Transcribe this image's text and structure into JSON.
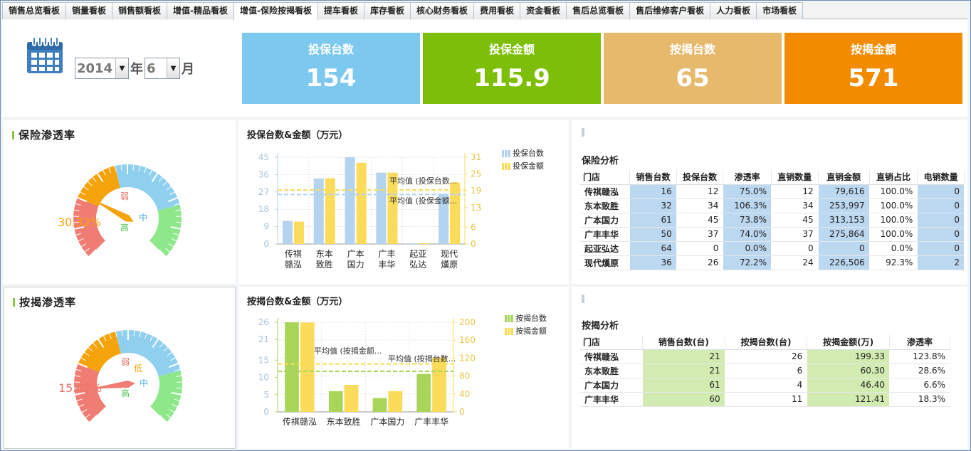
{
  "tabs": [
    {
      "label": "销售总览看板",
      "active": false
    },
    {
      "label": "销量看板",
      "active": false
    },
    {
      "label": "销售额看板",
      "active": false
    },
    {
      "label": "增值-精品看板",
      "active": false
    },
    {
      "label": "增值-保险按揭看板",
      "active": true
    },
    {
      "label": "提车看板",
      "active": false
    },
    {
      "label": "库存看板",
      "active": false
    },
    {
      "label": "核心财务看板",
      "active": false
    },
    {
      "label": "费用看板",
      "active": false
    },
    {
      "label": "资金看板",
      "active": false
    },
    {
      "label": "售后总览看板",
      "active": false
    },
    {
      "label": "售后维修客户看板",
      "active": false
    },
    {
      "label": "人力看板",
      "active": false
    },
    {
      "label": "市场看板",
      "active": false
    }
  ],
  "date": {
    "year": "2014",
    "year_unit": "年",
    "month": "6",
    "month_unit": "月",
    "icon": "calendar-icon"
  },
  "kpis": [
    {
      "title": "投保台数",
      "value": "154",
      "color": "#7cc8ef"
    },
    {
      "title": "投保金额",
      "value": "115.9",
      "color": "#7dbf08"
    },
    {
      "title": "按揭台数",
      "value": "65",
      "color": "#e6b96c"
    },
    {
      "title": "按揭金额",
      "value": "571",
      "color": "#f28b00"
    }
  ],
  "insurance_gauge": {
    "title": "保险渗透率",
    "percent_text": "30.32%",
    "percent_value": 30.32,
    "percent_color": "#f5a30a",
    "labels": {
      "weak": "弱",
      "mid": "中",
      "high": "高"
    }
  },
  "mortgage_gauge": {
    "title": "按揭渗透率",
    "percent_text": "15.67%",
    "percent_value": 15.67,
    "percent_color": "#f07367",
    "labels": {
      "weak": "弱",
      "low": "低",
      "mid": "中",
      "high": "高"
    }
  },
  "chart_data": [
    {
      "type": "bar",
      "title": "投保台数&金额（万元）",
      "categories": [
        "传祺\n赣泓",
        "东本\n致胜",
        "广本\n国力",
        "广丰\n丰华",
        "起亚\n弘达",
        "现代\n熯原"
      ],
      "series": [
        {
          "name": "投保台数",
          "values": [
            12,
            34,
            45,
            37,
            0,
            26
          ],
          "color": "#b4d3ee",
          "axis": "left"
        },
        {
          "name": "投保金额",
          "values": [
            8,
            23.5,
            29,
            25.5,
            0,
            22
          ],
          "color": "#fadc5a",
          "axis": "right"
        }
      ],
      "ylim_left": [
        0,
        45
      ],
      "yticks_left": [
        0,
        9,
        18,
        27,
        36,
        45
      ],
      "ylim_right": [
        0,
        31
      ],
      "yticks_right": [
        0,
        6,
        13,
        19,
        25,
        31
      ],
      "avg_lines": [
        {
          "label": "平均值 (投保台数...",
          "value": 25.7,
          "axis": "left",
          "color": "#b4d3ee"
        },
        {
          "label": "平均值 (投保金额...",
          "value": 19.3,
          "axis": "right",
          "color": "#fadc5a"
        }
      ],
      "legend": "top-right"
    },
    {
      "type": "bar",
      "title": "按揭台数&金额（万元）",
      "categories": [
        "传祺赣泓",
        "东本致胜",
        "广本国力",
        "广丰丰华"
      ],
      "series": [
        {
          "name": "按揭台数",
          "values": [
            26,
            6,
            4,
            11
          ],
          "color": "#a9d65a",
          "axis": "left"
        },
        {
          "name": "按揭金额",
          "values": [
            199.33,
            60.3,
            46.4,
            121.41
          ],
          "color": "#fadc5a",
          "axis": "right"
        }
      ],
      "ylim_left": [
        0,
        26
      ],
      "yticks_left": [
        0,
        5,
        10,
        15,
        21,
        26
      ],
      "ylim_right": [
        0,
        200
      ],
      "yticks_right": [
        0,
        40,
        80,
        120,
        160,
        200
      ],
      "avg_lines": [
        {
          "label": "平均值 (按揭金额...",
          "value": 106.9,
          "axis": "right",
          "color": "#fadc5a"
        },
        {
          "label": "平均值 (按揭台数...",
          "value": 11.75,
          "axis": "left",
          "color": "#a9d65a"
        }
      ],
      "legend": "top-right"
    }
  ],
  "insurance_table": {
    "title": "保险分析",
    "columns": [
      "门店",
      "销售台数",
      "投保台数",
      "渗透率",
      "直销数量",
      "直销金额",
      "直销占比",
      "电销数量"
    ],
    "rows": [
      [
        "传祺赣泓",
        "16",
        "12",
        "75.0%",
        "12",
        "79,616",
        "100.0%",
        "0"
      ],
      [
        "东本致胜",
        "32",
        "34",
        "106.3%",
        "34",
        "253,997",
        "100.0%",
        "0"
      ],
      [
        "广本国力",
        "61",
        "45",
        "73.8%",
        "45",
        "313,153",
        "100.0%",
        "0"
      ],
      [
        "广丰丰华",
        "50",
        "37",
        "74.0%",
        "37",
        "275,864",
        "100.0%",
        "0"
      ],
      [
        "起亚弘达",
        "64",
        "0",
        "0.0%",
        "0",
        "0",
        "0.0%",
        "0"
      ],
      [
        "现代熯原",
        "36",
        "26",
        "72.2%",
        "24",
        "226,506",
        "92.3%",
        "2"
      ]
    ],
    "highlight_cols": [
      1,
      3,
      5,
      7
    ]
  },
  "mortgage_table": {
    "title": "按揭分析",
    "columns": [
      "门店",
      "销售台数(台)",
      "按揭台数(台)",
      "按揭金额(万)",
      "渗透率"
    ],
    "rows": [
      [
        "传祺赣泓",
        "21",
        "26",
        "199.33",
        "123.8%"
      ],
      [
        "东本致胜",
        "21",
        "6",
        "60.30",
        "28.6%"
      ],
      [
        "广本国力",
        "61",
        "4",
        "46.40",
        "6.6%"
      ],
      [
        "广丰丰华",
        "60",
        "11",
        "121.41",
        "18.3%"
      ]
    ],
    "highlight_cols": [
      1,
      3
    ]
  }
}
